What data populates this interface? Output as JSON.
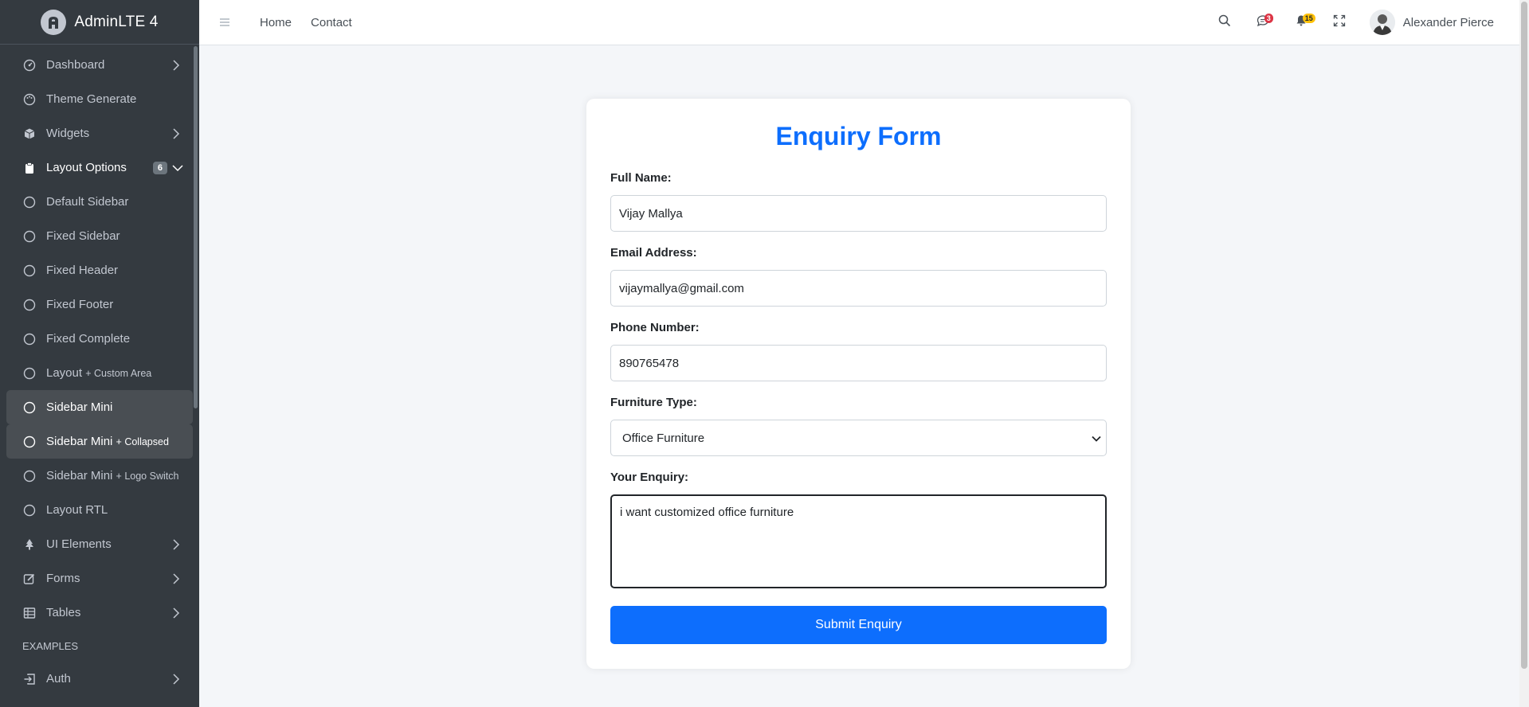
{
  "brand": {
    "name": "AdminLTE 4"
  },
  "sidebar": {
    "items": [
      {
        "label": "Dashboard",
        "icon": "speedometer-icon"
      },
      {
        "label": "Theme Generate",
        "icon": "palette-icon"
      },
      {
        "label": "Widgets",
        "icon": "box-icon"
      },
      {
        "label": "Layout Options",
        "icon": "clipboard-icon",
        "badge": "6"
      },
      {
        "label": "Default Sidebar"
      },
      {
        "label": "Fixed Sidebar"
      },
      {
        "label": "Fixed Header"
      },
      {
        "label": "Fixed Footer"
      },
      {
        "label": "Fixed Complete"
      },
      {
        "label": "Layout",
        "suffix": "+ Custom Area"
      },
      {
        "label": "Sidebar Mini"
      },
      {
        "label": "Sidebar Mini",
        "suffix": "+ Collapsed"
      },
      {
        "label": "Sidebar Mini",
        "suffix": "+ Logo Switch"
      },
      {
        "label": "Layout RTL"
      },
      {
        "label": "UI Elements",
        "icon": "tree-icon"
      },
      {
        "label": "Forms",
        "icon": "pencil-square-icon"
      },
      {
        "label": "Tables",
        "icon": "table-icon"
      }
    ],
    "header": "EXAMPLES",
    "auth": {
      "label": "Auth",
      "icon": "login-icon"
    }
  },
  "topbar": {
    "home": "Home",
    "contact": "Contact",
    "messages_badge": "3",
    "notifications_badge": "15",
    "user_name": "Alexander Pierce"
  },
  "form": {
    "title": "Enquiry Form",
    "full_name": {
      "label": "Full Name:",
      "value": "Vijay Mallya"
    },
    "email": {
      "label": "Email Address:",
      "value": "vijaymallya@gmail.com"
    },
    "phone": {
      "label": "Phone Number:",
      "value": "890765478"
    },
    "furniture": {
      "label": "Furniture Type:",
      "value": "Office Furniture"
    },
    "enquiry": {
      "label": "Your Enquiry:",
      "value": "i want customized office furniture"
    },
    "submit": "Submit Enquiry"
  },
  "colors": {
    "primary": "#0d6efd",
    "sidebar_bg": "#343a40",
    "active_bg": "#494e53"
  }
}
